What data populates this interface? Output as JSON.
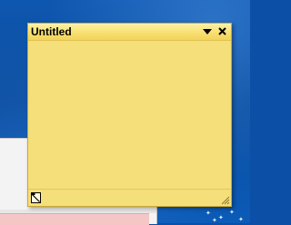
{
  "note": {
    "title": "Untitled",
    "body_text": "",
    "menu_icon": "triangle-down-icon",
    "close_icon": "close-icon",
    "footer_icon": "note-pin-icon",
    "grip_icon": "resize-grip-icon"
  },
  "colors": {
    "desktop": "#0b4fa6",
    "note_background": "#f4df7b",
    "note_border": "#c9a735"
  }
}
